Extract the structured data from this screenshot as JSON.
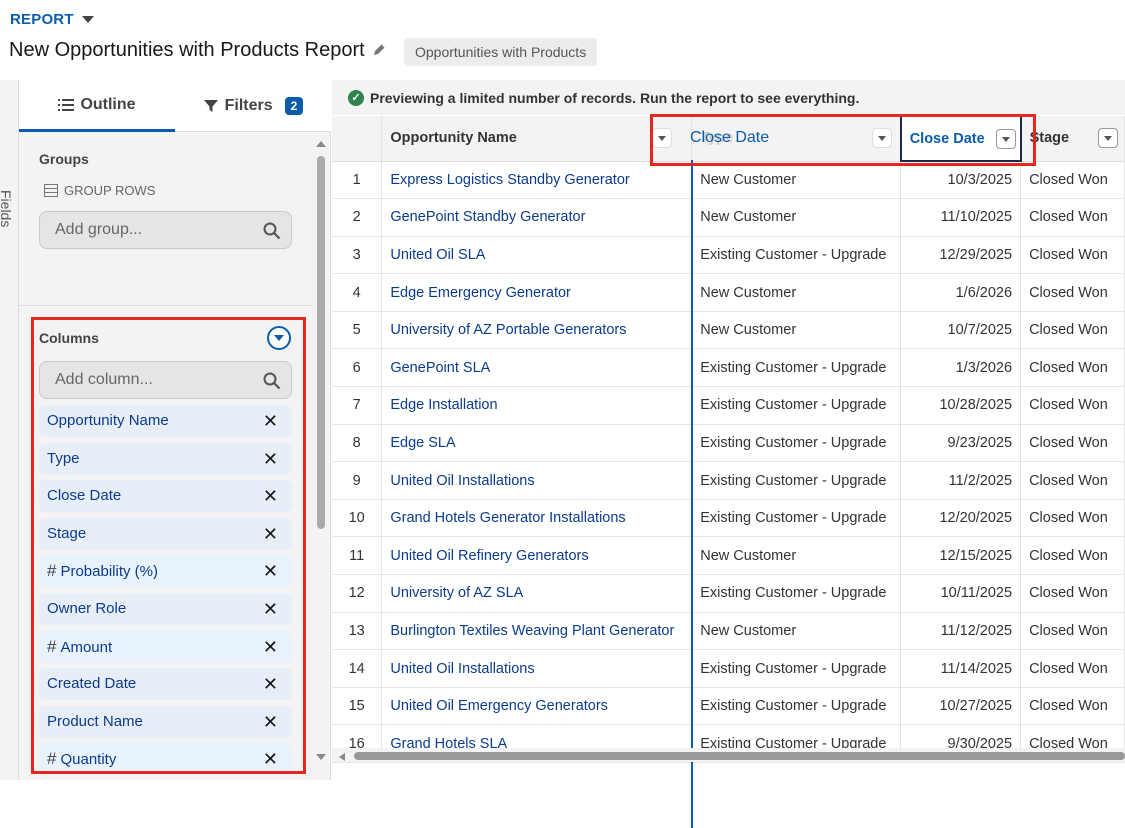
{
  "header": {
    "report_label": "REPORT",
    "title": "New Opportunities with Products Report",
    "report_type": "Opportunities with Products"
  },
  "sidebar": {
    "fields_label": "Fields",
    "tabs": {
      "outline": "Outline",
      "filters": "Filters",
      "filters_count": "2"
    },
    "groups": {
      "title": "Groups",
      "group_rows": "GROUP ROWS",
      "placeholder": "Add group..."
    },
    "columns": {
      "title": "Columns",
      "placeholder": "Add column...",
      "items": [
        {
          "label": "Opportunity Name",
          "prefix": ""
        },
        {
          "label": "Type",
          "prefix": ""
        },
        {
          "label": "Close Date",
          "prefix": ""
        },
        {
          "label": "Stage",
          "prefix": ""
        },
        {
          "label": "Probability (%)",
          "prefix": "#"
        },
        {
          "label": "Owner Role",
          "prefix": ""
        },
        {
          "label": "Amount",
          "prefix": "#"
        },
        {
          "label": "Created Date",
          "prefix": ""
        },
        {
          "label": "Product Name",
          "prefix": ""
        },
        {
          "label": "Quantity",
          "prefix": "#"
        }
      ]
    }
  },
  "preview": {
    "banner": "Previewing a limited number of records. Run the report to see everything."
  },
  "table": {
    "headers": {
      "opp_name": "Opportunity Name",
      "type": "Type",
      "close_date": "Close Date",
      "stage": "Stage"
    },
    "drag_label": "Close Date",
    "rows": [
      [
        "1",
        "Express Logistics Standby Generator",
        "New Customer",
        "10/3/2025",
        "Closed Won"
      ],
      [
        "2",
        "GenePoint Standby Generator",
        "New Customer",
        "11/10/2025",
        "Closed Won"
      ],
      [
        "3",
        "United Oil SLA",
        "Existing Customer - Upgrade",
        "12/29/2025",
        "Closed Won"
      ],
      [
        "4",
        "Edge Emergency Generator",
        "New Customer",
        "1/6/2026",
        "Closed Won"
      ],
      [
        "5",
        "University of AZ Portable Generators",
        "New Customer",
        "10/7/2025",
        "Closed Won"
      ],
      [
        "6",
        "GenePoint SLA",
        "Existing Customer - Upgrade",
        "1/3/2026",
        "Closed Won"
      ],
      [
        "7",
        "Edge Installation",
        "Existing Customer - Upgrade",
        "10/28/2025",
        "Closed Won"
      ],
      [
        "8",
        "Edge SLA",
        "Existing Customer - Upgrade",
        "9/23/2025",
        "Closed Won"
      ],
      [
        "9",
        "United Oil Installations",
        "Existing Customer - Upgrade",
        "11/2/2025",
        "Closed Won"
      ],
      [
        "10",
        "Grand Hotels Generator Installations",
        "Existing Customer - Upgrade",
        "12/20/2025",
        "Closed Won"
      ],
      [
        "11",
        "United Oil Refinery Generators",
        "New Customer",
        "12/15/2025",
        "Closed Won"
      ],
      [
        "12",
        "University of AZ SLA",
        "Existing Customer - Upgrade",
        "10/11/2025",
        "Closed Won"
      ],
      [
        "13",
        "Burlington Textiles Weaving Plant Generator",
        "New Customer",
        "11/12/2025",
        "Closed Won"
      ],
      [
        "14",
        "United Oil Installations",
        "Existing Customer - Upgrade",
        "11/14/2025",
        "Closed Won"
      ],
      [
        "15",
        "United Oil Emergency Generators",
        "Existing Customer - Upgrade",
        "10/27/2025",
        "Closed Won"
      ],
      [
        "16",
        "Grand Hotels SLA",
        "Existing Customer - Upgrade",
        "9/30/2025",
        "Closed Won"
      ]
    ]
  },
  "colors": {
    "accent": "#0b5cab",
    "highlight": "#e8251f",
    "success": "#2e844a"
  }
}
